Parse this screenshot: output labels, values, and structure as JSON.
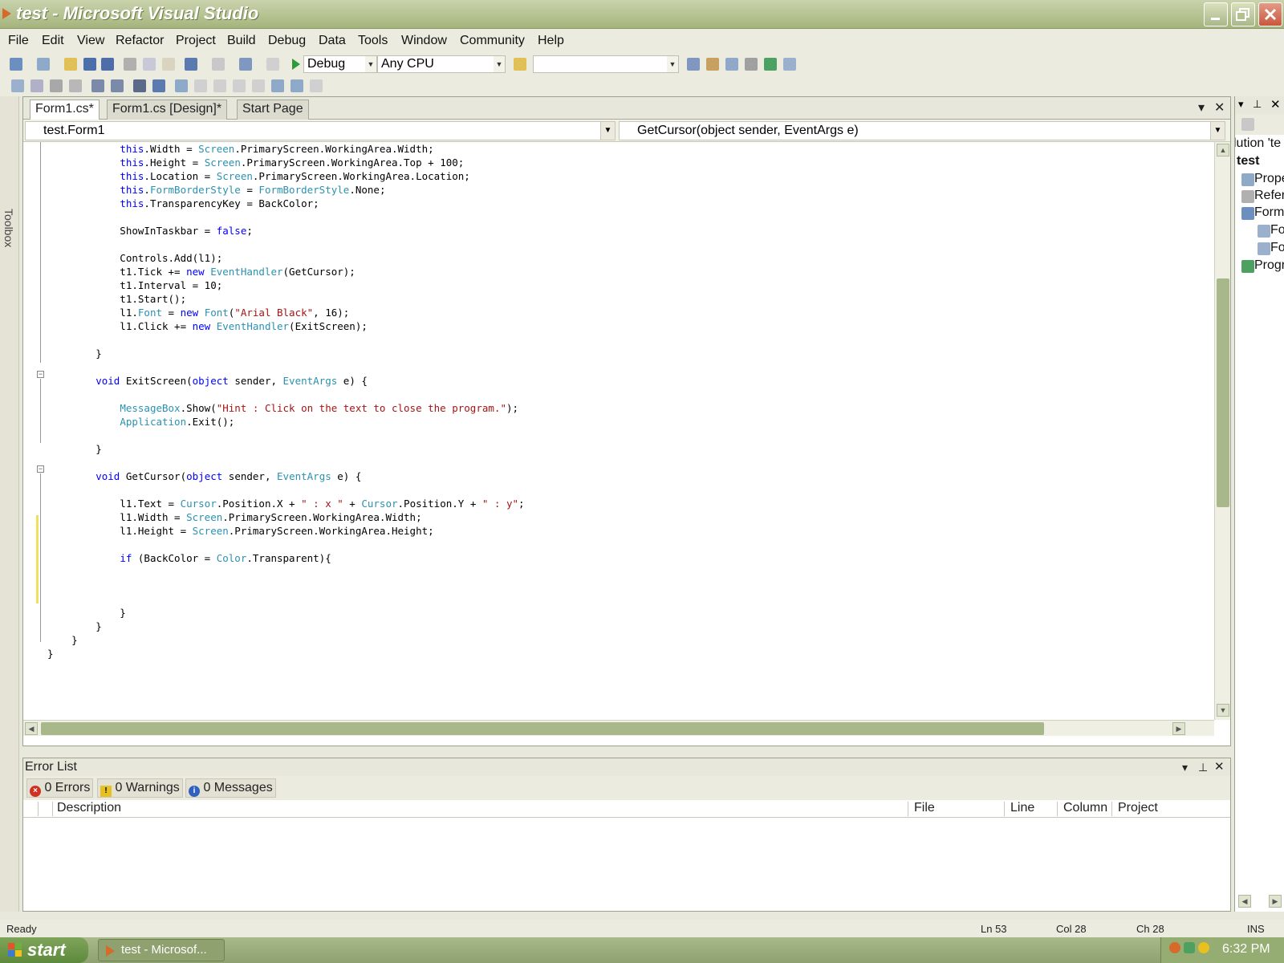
{
  "window": {
    "title": "test - Microsoft Visual Studio"
  },
  "menu": [
    "File",
    "Edit",
    "View",
    "Refactor",
    "Project",
    "Build",
    "Debug",
    "Data",
    "Tools",
    "Window",
    "Community",
    "Help"
  ],
  "toolbar": {
    "config": "Debug",
    "platform": "Any CPU",
    "find": ""
  },
  "toolbox": {
    "label": "Toolbox"
  },
  "tabs": [
    "Form1.cs*",
    "Form1.cs [Design]*",
    "Start Page"
  ],
  "navbar": {
    "class": "test.Form1",
    "member": "GetCursor(object sender, EventArgs e)"
  },
  "code_lines": [
    "            this.Width = Screen.PrimaryScreen.WorkingArea.Width;",
    "            this.Height = Screen.PrimaryScreen.WorkingArea.Top + 100;",
    "            this.Location = Screen.PrimaryScreen.WorkingArea.Location;",
    "            this.FormBorderStyle = FormBorderStyle.None;",
    "            this.TransparencyKey = BackColor;",
    "",
    "            ShowInTaskbar = false;",
    "",
    "            Controls.Add(l1);",
    "            t1.Tick += new EventHandler(GetCursor);",
    "            t1.Interval = 10;",
    "            t1.Start();",
    "            l1.Font = new Font(\"Arial Black\", 16);",
    "            l1.Click += new EventHandler(ExitScreen);",
    "",
    "        }",
    "",
    "        void ExitScreen(object sender, EventArgs e) {",
    "",
    "            MessageBox.Show(\"Hint : Click on the text to close the program.\");",
    "            Application.Exit();",
    "",
    "        }",
    "",
    "        void GetCursor(object sender, EventArgs e) {",
    "",
    "            l1.Text = Cursor.Position.X + \" : x \" + Cursor.Position.Y + \" : y\";",
    "            l1.Width = Screen.PrimaryScreen.WorkingArea.Width;",
    "            l1.Height = Screen.PrimaryScreen.WorkingArea.Height;",
    "",
    "            if (BackColor = Color.Transparent){",
    "",
    "",
    "",
    "            }",
    "        }",
    "    }",
    "}"
  ],
  "solution": {
    "items": [
      "lution 'te",
      "test",
      "Prope",
      "Refer",
      "Form",
      "Fo",
      "Fo",
      "Progr"
    ]
  },
  "errors": {
    "title": "Error List",
    "errors_btn": "0 Errors",
    "warnings_btn": "0 Warnings",
    "messages_btn": "0 Messages",
    "columns": [
      "Description",
      "File",
      "Line",
      "Column",
      "Project"
    ]
  },
  "status": {
    "text": "Ready",
    "ln": "Ln 53",
    "col": "Col 28",
    "ch": "Ch 28",
    "mode": "INS"
  },
  "taskbar": {
    "start": "start",
    "task": "test - Microsof...",
    "time": "6:32 PM"
  },
  "colors": {
    "keyword": "#0000ff",
    "type": "#2b91af",
    "string": "#a31515",
    "theme": "#a9b88b"
  }
}
